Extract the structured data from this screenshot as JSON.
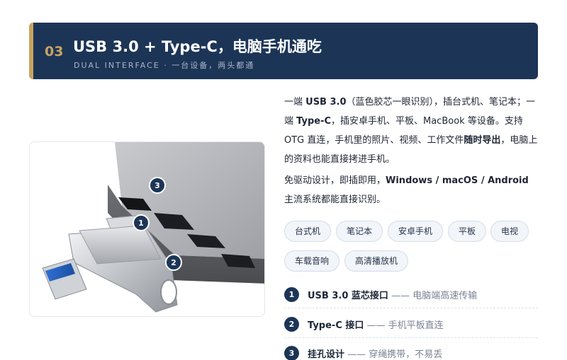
{
  "header": {
    "number": "03",
    "title": "USB 3.0 + Type-C，电脑手机通吃",
    "subtitle": "DUAL INTERFACE · 一台设备，两头都通"
  },
  "image": {
    "callouts": [
      "1",
      "2",
      "3"
    ]
  },
  "description": {
    "p1": [
      {
        "text": "一端 ",
        "bold": false
      },
      {
        "text": "USB 3.0",
        "bold": true
      },
      {
        "text": "（蓝色胶芯一眼识别），插台式机、笔记本；一端 ",
        "bold": false
      },
      {
        "text": "Type-C",
        "bold": true
      },
      {
        "text": "，插安卓手机、平板、MacBook 等设备。支持 OTG 直连，手机里的照片、视频、工作文件",
        "bold": false
      },
      {
        "text": "随时导出",
        "bold": true
      },
      {
        "text": "，电脑上的资料也能直接拷进手机。",
        "bold": false
      }
    ],
    "p2": [
      {
        "text": "免驱动设计，即插即用，",
        "bold": false
      },
      {
        "text": "Windows / macOS / Android",
        "bold": true
      },
      {
        "text": " 主流系统都能直接识别。",
        "bold": false
      }
    ]
  },
  "tags": [
    "台式机",
    "笔记本",
    "安卓手机",
    "平板",
    "电视",
    "车载音响",
    "高清播放机"
  ],
  "features": [
    {
      "number": "1",
      "name": "USB 3.0 蓝芯接口",
      "separator": "——",
      "desc": "电脑端高速传输"
    },
    {
      "number": "2",
      "name": "Type-C 接口",
      "separator": "——",
      "desc": "手机平板直连"
    },
    {
      "number": "3",
      "name": "挂孔设计",
      "separator": "——",
      "desc": "穿绳携带，不易丢"
    }
  ],
  "colors": {
    "header_bg": "#1c3557",
    "accent_gold": "#c9a460",
    "badge_bg": "#1c3557",
    "tag_bg": "#f2f5f9"
  }
}
